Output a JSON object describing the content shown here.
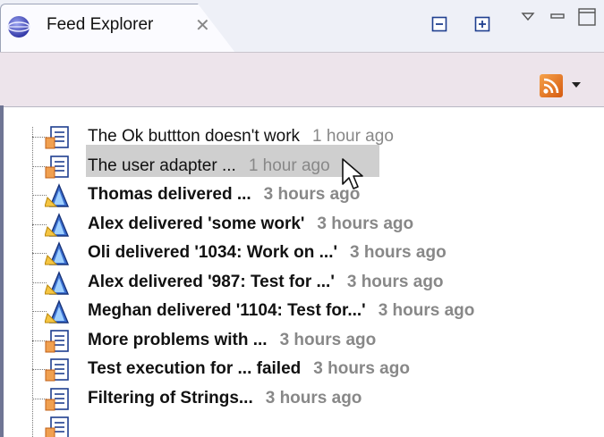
{
  "view": {
    "tab_title": "Feed Explorer",
    "tab_close": "✕",
    "accent": "#6f7594",
    "selection_color": "#cfcfcf"
  },
  "toolbar": {
    "feed_icon": "rss-icon",
    "menu_icon": "dropdown-caret-icon"
  },
  "feed_items": [
    {
      "icon": "work-item-icon",
      "title": "The Ok buttton doesn't work",
      "time": "1 hour ago",
      "bold": false,
      "selected": false
    },
    {
      "icon": "work-item-icon",
      "title": "The user adapter ...",
      "time": "1 hour ago",
      "bold": false,
      "selected": true
    },
    {
      "icon": "delivery-icon",
      "title": "Thomas delivered ...",
      "time": "3 hours ago",
      "bold": true,
      "selected": false
    },
    {
      "icon": "delivery-icon",
      "title": "Alex delivered 'some work'",
      "time": "3 hours ago",
      "bold": true,
      "selected": false
    },
    {
      "icon": "delivery-icon",
      "title": "Oli delivered '1034: Work on ...'",
      "time": "3 hours ago",
      "bold": true,
      "selected": false
    },
    {
      "icon": "delivery-icon",
      "title": "Alex delivered '987: Test for ...'",
      "time": "3 hours ago",
      "bold": true,
      "selected": false
    },
    {
      "icon": "delivery-icon",
      "title": "Meghan delivered '1104: Test for...'",
      "time": "3 hours ago",
      "bold": true,
      "selected": false
    },
    {
      "icon": "work-item-icon",
      "title": "More problems with ...",
      "time": "3 hours ago",
      "bold": true,
      "selected": false
    },
    {
      "icon": "work-item-icon",
      "title": "Test execution for ... failed",
      "time": "3 hours ago",
      "bold": true,
      "selected": false
    },
    {
      "icon": "work-item-icon",
      "title": "Filtering of Strings...",
      "time": "3 hours ago",
      "bold": true,
      "selected": false
    }
  ]
}
